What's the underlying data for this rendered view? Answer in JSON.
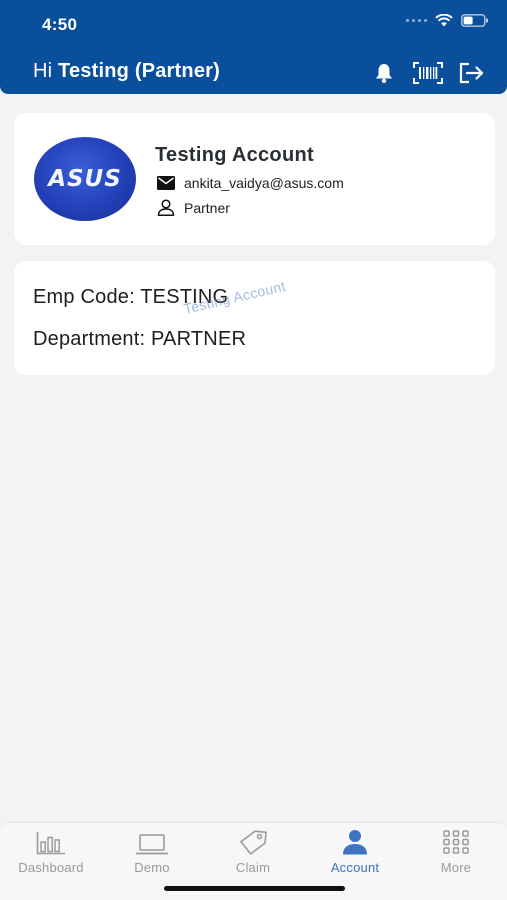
{
  "status_bar": {
    "time": "4:50"
  },
  "header": {
    "greeting_prefix": "Hi ",
    "greeting_name": "Testing (Partner)"
  },
  "profile": {
    "logo_text": "ASUS",
    "name": "Testing Account",
    "email": "ankita_vaidya@asus.com",
    "role": "Partner"
  },
  "details": {
    "emp_code": "Emp Code: TESTING",
    "department": "Department: PARTNER",
    "watermark": "Testing Account"
  },
  "tabs": [
    {
      "label": "Dashboard",
      "icon": "bar-chart-icon",
      "active": false
    },
    {
      "label": "Demo",
      "icon": "laptop-icon",
      "active": false
    },
    {
      "label": "Claim",
      "icon": "tag-icon",
      "active": false
    },
    {
      "label": "Account",
      "icon": "person-icon",
      "active": true
    },
    {
      "label": "More",
      "icon": "grid-icon",
      "active": false
    }
  ],
  "colors": {
    "header_bg": "#0a4f9c",
    "active_tab": "#3d73c0",
    "inactive_tab": "#9a9a9a"
  }
}
